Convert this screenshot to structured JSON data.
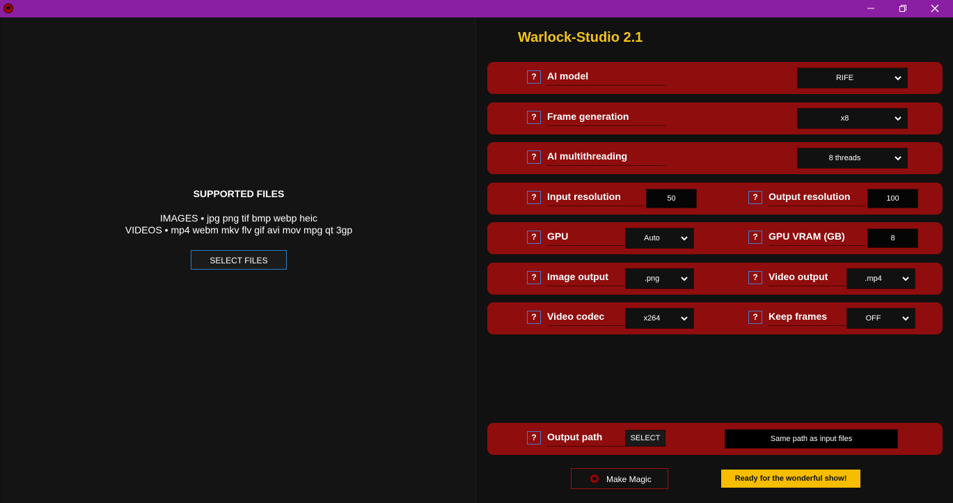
{
  "window": {
    "minimize": "—",
    "maximize": "❐",
    "close": "✕"
  },
  "left": {
    "supported_title": "SUPPORTED FILES",
    "images_line": "IMAGES • jpg png tif bmp webp heic",
    "videos_line": "VIDEOS • mp4 webm mkv flv gif avi mov mpg qt 3gp",
    "select_files": "SELECT FILES"
  },
  "app_title": "Warlock-Studio 2.1",
  "help_symbol": "?",
  "settings": {
    "ai_model": {
      "label": "AI model",
      "value": "RIFE"
    },
    "frame_generation": {
      "label": "Frame generation",
      "value": "x8"
    },
    "ai_multithreading": {
      "label": "AI multithreading",
      "value": "8 threads"
    },
    "input_resolution": {
      "label": "Input resolution",
      "value": "50"
    },
    "output_resolution": {
      "label": "Output resolution",
      "value": "100"
    },
    "gpu": {
      "label": "GPU",
      "value": "Auto"
    },
    "gpu_vram": {
      "label": "GPU VRAM (GB)",
      "value": "8"
    },
    "image_output": {
      "label": "Image output",
      "value": ".png"
    },
    "video_output": {
      "label": "Video output",
      "value": ".mp4"
    },
    "video_codec": {
      "label": "Video codec",
      "value": "x264"
    },
    "keep_frames": {
      "label": "Keep frames",
      "value": "OFF"
    }
  },
  "output_path": {
    "label": "Output path",
    "select": "SELECT",
    "value": "Same path as input files"
  },
  "actions": {
    "make_magic": "Make Magic",
    "status": "Ready for the wonderful show!"
  },
  "colors": {
    "titlebar": "#8b1fa3",
    "panel": "#8f0d0d",
    "accent_title": "#f2c21c",
    "status": "#f7bd00",
    "help_border": "#4a78c8"
  }
}
